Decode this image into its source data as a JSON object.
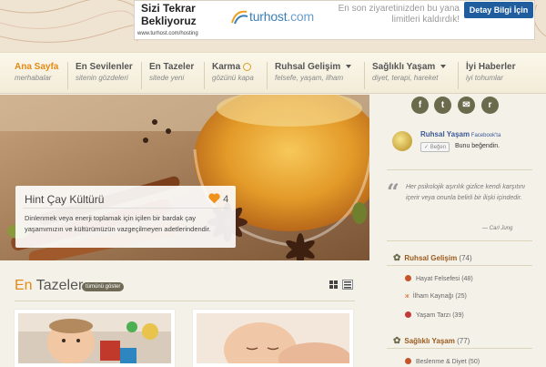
{
  "ad": {
    "headline_1": "Sizi Tekrar",
    "headline_2": "Bekliyoruz",
    "url": "www.turhost.com/hosting",
    "brand_main": "turhost",
    "brand_tld": ".com",
    "message": "En son ziyaretinizden bu yana limitleri kaldırdık!",
    "button": "Detay Bilgi İçin"
  },
  "nav": {
    "items": [
      {
        "title": "Ana Sayfa",
        "sub": "merhabalar"
      },
      {
        "title": "En Sevilenler",
        "sub": "sitenin gözdeleri"
      },
      {
        "title": "En Tazeler",
        "sub": "sitede yeni"
      },
      {
        "title": "Karma",
        "sub": "gözünü kapa"
      },
      {
        "title": "Ruhsal Gelişim",
        "sub": "felsefe, yaşam, ilham"
      },
      {
        "title": "Sağlıklı Yaşam",
        "sub": "diyet, terapi, hareket"
      },
      {
        "title": "İyi Haberler",
        "sub": "iyi tohumlar"
      }
    ]
  },
  "hero": {
    "title": "Hint Çay Kültürü",
    "likes": "4",
    "description": "Dinlenmek veya enerji toplamak için içilen bir bardak çay yaşamımızın ve kültürümüzün vazgeçilmeyen adetlerindendir."
  },
  "latest": {
    "title_accent": "En",
    "title_rest": " Tazeler",
    "show_all": "tümünü göster"
  },
  "social": {
    "facebook": "f",
    "twitter": "t",
    "mail": "✉",
    "rss": "r"
  },
  "fb": {
    "page_name": "Ruhsal Yaşam",
    "page_suffix": " Facebook'ta",
    "like_button": "Beğen",
    "like_text": "Bunu beğendin."
  },
  "quote": {
    "text": "Her psikolojik aşırılık gizlice kendi karşıtını içerir veya onunla belirli bir ilişki içindedir.",
    "author": "— Carl Jung"
  },
  "categories": [
    {
      "name": "Ruhsal Gelişim",
      "count": "(74)",
      "items": [
        {
          "label": "Hayat Felsefesi",
          "count": "(48)",
          "color": "#c4552a"
        },
        {
          "label": "İlham Kaynağı",
          "count": "(25)",
          "color": "#d96a2a"
        },
        {
          "label": "Yaşam Tarzı",
          "count": "(39)",
          "color": "#c23b3b"
        }
      ]
    },
    {
      "name": "Sağlıklı Yaşam",
      "count": "(77)",
      "items": [
        {
          "label": "Beslenme & Diyet",
          "count": "(50)",
          "color": "#c4552a"
        }
      ]
    }
  ],
  "colors": {
    "accent": "#e48a16",
    "social": "#6b6a4c",
    "fb_blue": "#3b5998",
    "category": "#9a5a1e"
  }
}
